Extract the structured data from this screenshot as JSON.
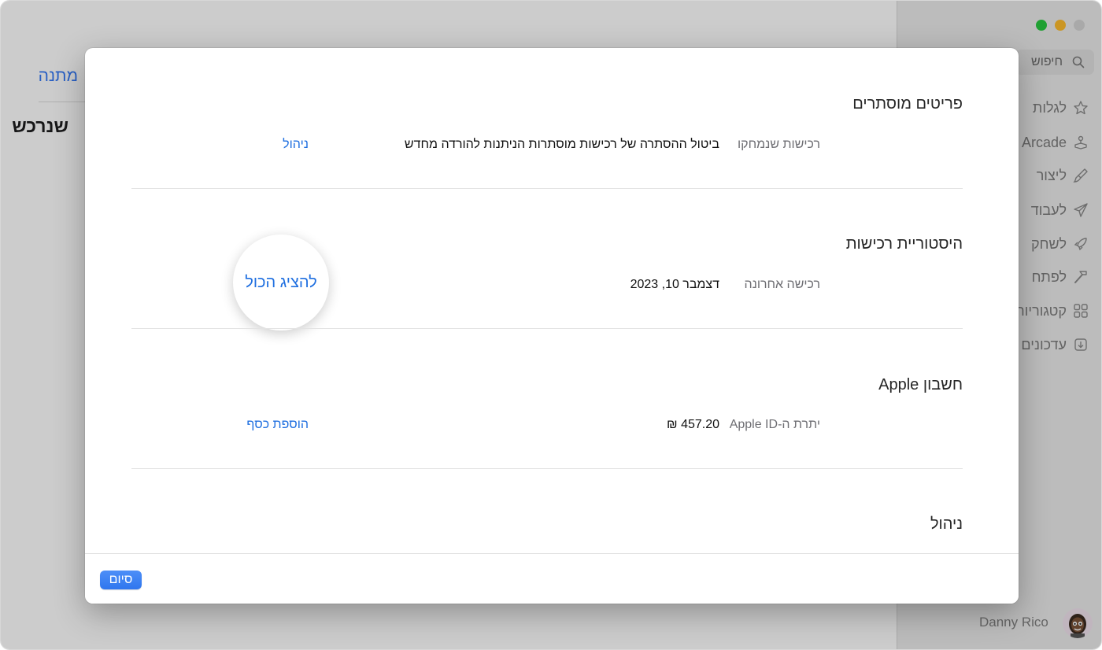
{
  "background": {
    "main_link": "מתנה",
    "main_title": "שנרכש",
    "search_placeholder": "חיפוש",
    "nav": [
      {
        "label": "לגלות",
        "icon": "star-icon"
      },
      {
        "label": "Arcade",
        "icon": "joystick-icon"
      },
      {
        "label": "ליצור",
        "icon": "brush-icon"
      },
      {
        "label": "לעבוד",
        "icon": "paper-plane-icon"
      },
      {
        "label": "לשחק",
        "icon": "rocket-icon"
      },
      {
        "label": "לפתח",
        "icon": "hammer-icon"
      },
      {
        "label": "קטגוריות",
        "icon": "grid-icon"
      },
      {
        "label": "עדכונים",
        "icon": "download-icon"
      }
    ],
    "user_name": "Danny Rico"
  },
  "modal": {
    "sections": [
      {
        "title": "פריטים מוסתרים",
        "row_label": "רכישות שנמחקו",
        "row_value": "ביטול ההסתרה של רכישות מוסתרות הניתנות להורדה מחדש",
        "action": "ניהול"
      },
      {
        "title": "היסטוריית רכישות",
        "row_label": "רכישה אחרונה",
        "row_value": "דצמבר 10, 2023",
        "action": "להציג הכול"
      },
      {
        "title": "חשבון Apple",
        "row_label": "יתרת ה-Apple ID",
        "row_value": "457.20 ₪",
        "action": "הוספת כסף"
      },
      {
        "title": "ניהול"
      }
    ],
    "done_label": "סיום"
  },
  "colors": {
    "accent": "#1f6fe0",
    "button": "#3a80f2"
  }
}
